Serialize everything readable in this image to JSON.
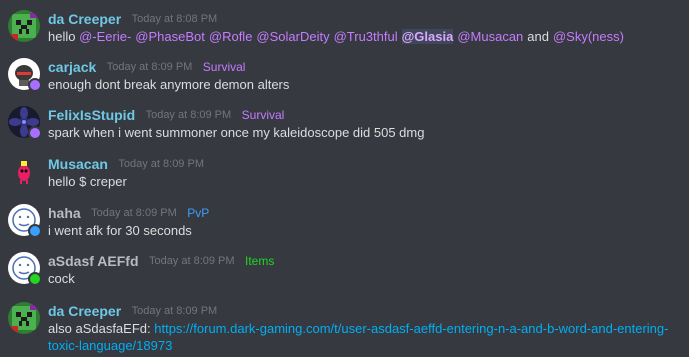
{
  "messages": [
    {
      "username": "da Creeper",
      "username_color": "#6fc8e6",
      "timestamp": "Today at 8:08 PM",
      "role": null,
      "avatar": "creeper-avatar",
      "content_before": "hello",
      "mentions": [
        "@-Eerie-",
        "@PhaseBot",
        "@Rofle",
        "@SolarDeity",
        "@Tru3thful",
        "@Glasia",
        "@Musacan",
        "@Sky(ness)"
      ],
      "mentions_bold_index": 5,
      "mentions_joiner": "and"
    },
    {
      "username": "carjack",
      "username_color": "#6fc8e6",
      "timestamp": "Today at 8:09 PM",
      "role": "Survival",
      "role_color": "#c57cff",
      "avatar": "helmet-avatar",
      "status_color": "#a970ff",
      "content": "enough dont break anymore demon alters"
    },
    {
      "username": "FelixIsStupid",
      "username_color": "#6fc8e6",
      "timestamp": "Today at 8:09 PM",
      "role": "Survival",
      "role_color": "#c57cff",
      "avatar": "dark-flower-avatar",
      "status_color": "#a970ff",
      "content": "spark when i went summoner once my kaleidoscope did 505 dmg"
    },
    {
      "username": "Musacan",
      "username_color": "#6fc8e6",
      "timestamp": "Today at 8:09 PM",
      "role": null,
      "avatar": "pink-creature-avatar",
      "content": "hello $ creper"
    },
    {
      "username": "haha",
      "username_color": "#b9bbbe",
      "timestamp": "Today at 8:09 PM",
      "role": "PvP",
      "role_color": "#3aa0ff",
      "avatar": "default-face-avatar",
      "status_color": "#3aa0ff",
      "content": "i went afk for 30 seconds"
    },
    {
      "username": "aSdasf AEFfd",
      "username_color": "#b9bbbe",
      "timestamp": "Today at 8:09 PM",
      "role": "Items",
      "role_color": "#22d622",
      "avatar": "default-face-avatar",
      "status_color": "#22d622",
      "content": "cock"
    },
    {
      "username": "da Creeper",
      "username_color": "#6fc8e6",
      "timestamp": "Today at 8:09 PM",
      "role": null,
      "avatar": "creeper-avatar",
      "content_before": "also aSdasfaEFd:",
      "link": "https://forum.dark-gaming.com/t/user-asdasf-aeffd-entering-n-a-and-b-word-and-entering-toxic-language/18973"
    }
  ],
  "colors": {
    "background": "#36393f",
    "text": "#dcddde",
    "timestamp": "#72767d",
    "mention": "#c57cff",
    "link": "#00aff4"
  }
}
